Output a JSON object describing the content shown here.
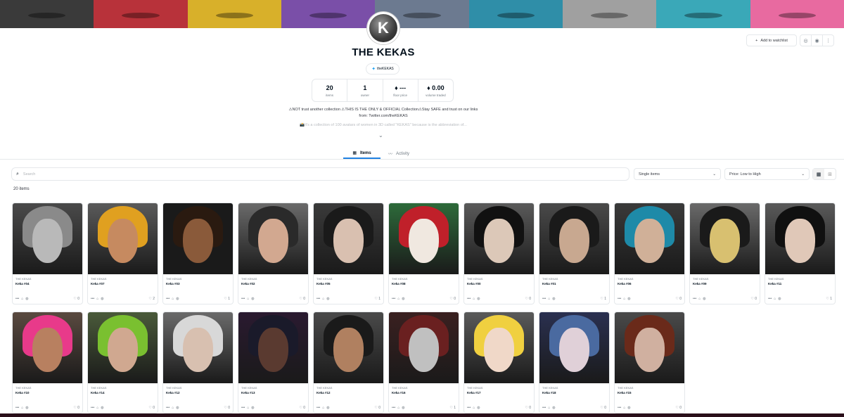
{
  "banner": [
    "#3a3a3a",
    "#b8323a",
    "#d8b02a",
    "#7a4fa8",
    "#6c7a90",
    "#2f8ea8",
    "#a0a0a0",
    "#3aa8b8",
    "#e86aa0"
  ],
  "collection": {
    "avatar_letter": "K",
    "title": "THE KEKAS",
    "twitter_handle": "theKEKAS",
    "stats": [
      {
        "value": "20",
        "label": "items"
      },
      {
        "value": "1",
        "label": "owner"
      },
      {
        "value": "♦ ---",
        "label": "floor price"
      },
      {
        "value": "♦ 0.00",
        "label": "volume traded"
      }
    ],
    "description_line1": "⚠NOT trust another collection ⚠THIS IS THE ONLY & OFFICIAL Collection⚠Stay SAFE and trust on our links from: Twitter.com/theKEKAS",
    "description_line2": "📸It's a collection of 100 avatars of women in 3D called \"KEKAS\" because is the abbreviation of...",
    "watchlist_label": "Add to watchlist"
  },
  "tabs": [
    {
      "label": "Items",
      "active": true
    },
    {
      "label": "Activity",
      "active": false
    }
  ],
  "filters": {
    "search_placeholder": "Search",
    "type_select": "Single items",
    "sort_select": "Price: Low to High"
  },
  "results_count": "20 items",
  "items": [
    {
      "collection": "THE KEKAS",
      "name": "Keka #04",
      "likes": "0",
      "bg": "#4a4a4a",
      "hair": "#8a8a8a",
      "skin": "#b9b9b9"
    },
    {
      "collection": "THE KEKAS",
      "name": "Keka #07",
      "likes": "2",
      "bg": "#5a5a5a",
      "hair": "#e0a020",
      "skin": "#c68a60"
    },
    {
      "collection": "THE KEKAS",
      "name": "Keka #03",
      "likes": "1",
      "bg": "#1a1a1a",
      "hair": "#2a1a10",
      "skin": "#8a5a3a"
    },
    {
      "collection": "THE KEKAS",
      "name": "Keka #02",
      "likes": "0",
      "bg": "#6a6a6a",
      "hair": "#2a2a2a",
      "skin": "#d2a890"
    },
    {
      "collection": "THE KEKAS",
      "name": "Keka #05",
      "likes": "1",
      "bg": "#3a3a3a",
      "hair": "#1a1a1a",
      "skin": "#d9c0b0"
    },
    {
      "collection": "THE KEKAS",
      "name": "Keka #08",
      "likes": "0",
      "bg": "#2d6a3a",
      "hair": "#c0202a",
      "skin": "#f0e8e0"
    },
    {
      "collection": "THE KEKAS",
      "name": "Keka #00",
      "likes": "0",
      "bg": "#5a5a5a",
      "hair": "#111111",
      "skin": "#dcc8b8"
    },
    {
      "collection": "THE KEKAS",
      "name": "Keka #01",
      "likes": "1",
      "bg": "#4a4a4a",
      "hair": "#1a1a1a",
      "skin": "#c8a890"
    },
    {
      "collection": "THE KEKAS",
      "name": "Keka #06",
      "likes": "0",
      "bg": "#3a3a3a",
      "hair": "#1e8aa8",
      "skin": "#d0b098"
    },
    {
      "collection": "THE KEKAS",
      "name": "Keka #09",
      "likes": "0",
      "bg": "#6a6a6a",
      "hair": "#1a1a1a",
      "skin": "#d8c070"
    },
    {
      "collection": "THE KEKAS",
      "name": "Keka #11",
      "likes": "1",
      "bg": "#5a5a5a",
      "hair": "#101010",
      "skin": "#e0c8b8"
    },
    {
      "collection": "THE KEKAS",
      "name": "Keka #10",
      "likes": "0",
      "bg": "#5a4a40",
      "hair": "#e83a8a",
      "skin": "#b88060"
    },
    {
      "collection": "THE KEKAS",
      "name": "Keka #14",
      "likes": "0",
      "bg": "#4a5a3a",
      "hair": "#7ac030",
      "skin": "#d0a890"
    },
    {
      "collection": "THE KEKAS",
      "name": "Keka #12",
      "likes": "0",
      "bg": "#6a6a6a",
      "hair": "#d8d8d8",
      "skin": "#d8c0b0"
    },
    {
      "collection": "THE KEKAS",
      "name": "Keka #13",
      "likes": "0",
      "bg": "#2a1a30",
      "hair": "#1a1a2a",
      "skin": "#5a3a30"
    },
    {
      "collection": "THE KEKAS",
      "name": "Keka #12",
      "likes": "0",
      "bg": "#4a4a4a",
      "hair": "#1a1a1a",
      "skin": "#b08060"
    },
    {
      "collection": "THE KEKAS",
      "name": "Keka #16",
      "likes": "1",
      "bg": "#3a2020",
      "hair": "#6a2020",
      "skin": "#c0c0c0"
    },
    {
      "collection": "THE KEKAS",
      "name": "Keka #17",
      "likes": "0",
      "bg": "#5a5a5a",
      "hair": "#f0d040",
      "skin": "#f0d8c8"
    },
    {
      "collection": "THE KEKAS",
      "name": "Keka #18",
      "likes": "0",
      "bg": "#2a3050",
      "hair": "#4a6aa0",
      "skin": "#e0d0d8"
    },
    {
      "collection": "THE KEKAS",
      "name": "Keka #15",
      "likes": "0",
      "bg": "#4a4a4a",
      "hair": "#6a2a1a",
      "skin": "#d0b0a0"
    }
  ]
}
